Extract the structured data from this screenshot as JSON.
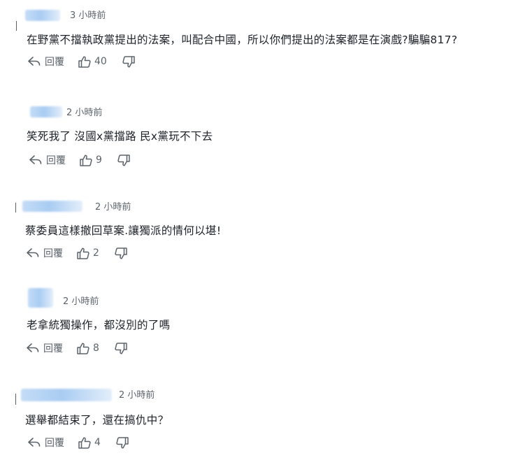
{
  "labels": {
    "reply": "回覆"
  },
  "icons": {
    "reply": "reply-arrow-icon",
    "like": "thumbs-up-icon",
    "dislike": "thumbs-down-icon"
  },
  "colors": {
    "text": "#1d2228",
    "meta": "#5b636a",
    "blurred_username": "#a9ccf2"
  },
  "comments": [
    {
      "time": "3 小時前",
      "text": "在野黨不擋執政黨提出的法案，叫配合中國，所以你們提出的法案都是在演戲?騙騙817?",
      "likes": "40"
    },
    {
      "time": "2 小時前",
      "text": "笑死我了 沒國x黨擋路 民x黨玩不下去",
      "likes": "9"
    },
    {
      "time": "2 小時前",
      "text": "蔡委員這樣撤回草案.讓獨派的情何以堪!",
      "likes": "2"
    },
    {
      "time": "2 小時前",
      "text": "老拿統獨操作，都沒別的了嗎",
      "likes": "8"
    },
    {
      "time": "2 小時前",
      "text": "選舉都結束了，還在搞仇中？",
      "likes": "4"
    }
  ]
}
